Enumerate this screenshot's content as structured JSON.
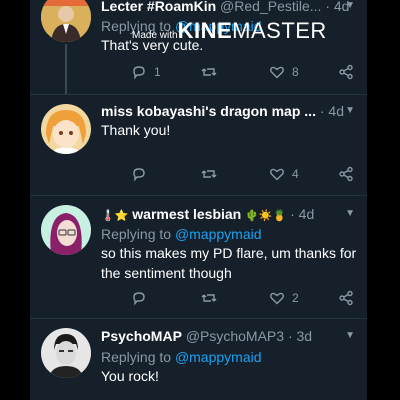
{
  "watermark": {
    "prefix": "Made with",
    "brand_bold": "KINE",
    "brand_rest": "MASTER"
  },
  "tweets": [
    {
      "name": "Lecter #RoamKin",
      "handle": "@Red_Pestile...",
      "time": "4d",
      "reply_prefix": "Replying to",
      "reply_to": "@mappymaid",
      "text": "That's very cute.",
      "replies": "1",
      "retweets": "",
      "likes": "8"
    },
    {
      "name": "miss kobayashi's dragon map ...",
      "handle": "",
      "time": "4d",
      "text": "Thank you!",
      "replies": "",
      "retweets": "",
      "likes": "4"
    },
    {
      "name_emoji_left": "🌡️⭐",
      "name": "warmest lesbian",
      "name_emoji_right": "🌵☀️🍍",
      "time": "4d",
      "reply_prefix": "Replying to",
      "reply_to": "@mappymaid",
      "text": "so this makes my PD flare, um thanks for the sentiment though",
      "replies": "",
      "retweets": "",
      "likes": "2"
    },
    {
      "name": "PsychoMAP",
      "handle": "@PsychoMAP3",
      "time": "3d",
      "reply_prefix": "Replying to",
      "reply_to": "@mappymaid",
      "text": "You rock!"
    }
  ],
  "colors": {
    "background": "#15202b",
    "text": "#ffffff",
    "muted": "#8899a6",
    "link": "#1da1f2"
  }
}
